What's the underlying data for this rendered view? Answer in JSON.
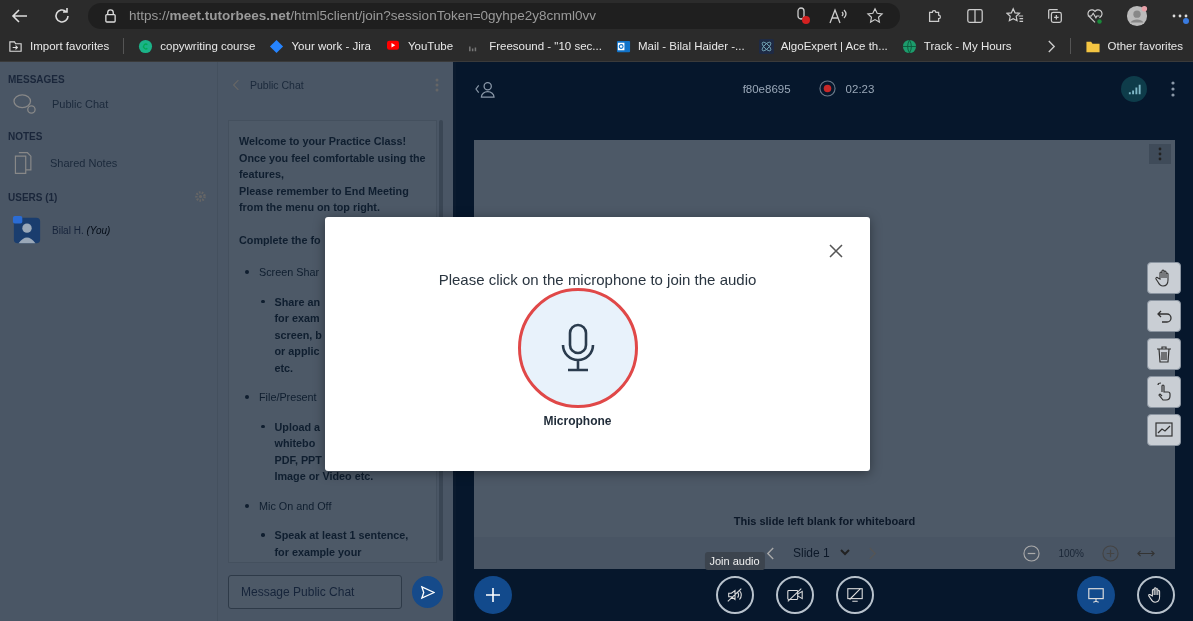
{
  "browser": {
    "url": "https://**meet.tutorbees.net**/html5client/join?sessionToken=0gyhpe2y8cnml0vv",
    "bookmarks": [
      {
        "label": "Import favorites",
        "kind": "import"
      },
      {
        "label": "copywriting course",
        "kind": "letter-circle"
      },
      {
        "label": "Your work - Jira",
        "kind": "diamond"
      },
      {
        "label": "YouTube",
        "kind": "play"
      },
      {
        "label": "Freesound - \"10 sec...",
        "kind": "wave"
      },
      {
        "label": "Mail - Bilal Haider -...",
        "kind": "mail"
      },
      {
        "label": "AlgoExpert | Ace th...",
        "kind": "atom"
      },
      {
        "label": "Track - My Hours",
        "kind": "globe"
      }
    ],
    "other_favorites": "Other favorites"
  },
  "sidebar": {
    "sections": [
      {
        "title": "MESSAGES",
        "items": [
          {
            "label": "Public Chat",
            "kind": "chat"
          }
        ]
      },
      {
        "title": "NOTES",
        "items": [
          {
            "label": "Shared Notes",
            "kind": "notes"
          }
        ]
      }
    ],
    "users_title": "USERS (1)",
    "users": [
      {
        "name": "Bilal H.",
        "suffix": "(You)"
      }
    ]
  },
  "chat": {
    "title": "Public Chat",
    "intro": [
      "Welcome to your Practice Class!",
      "Once you feel comfortable using the features,",
      "Please remember to End Meeting from the menu on top right."
    ],
    "heading": "Complete the fo",
    "bullets": [
      {
        "lines": [
          "Screen Shar"
        ],
        "children": [
          {
            "lines": [
              "Share an",
              "for exam",
              "screen, b",
              "or applic",
              "etc."
            ]
          }
        ]
      },
      {
        "lines": [
          "File/Present"
        ],
        "children": [
          {
            "lines": [
              "Upload a",
              "whitebo",
              "PDF, PPT",
              "Image or Video etc."
            ]
          }
        ]
      },
      {
        "lines": [
          "Mic On and Off"
        ],
        "children": [
          {
            "lines": [
              "Speak at least 1 sentence,",
              "for example your"
            ]
          }
        ]
      }
    ],
    "input": {
      "placeholder": "Message Public Chat"
    }
  },
  "meeting": {
    "name": "f80e8695",
    "time": "02:23",
    "slide_note": "This slide left blank for whiteboard",
    "slide": "Slide 1",
    "zoom": "100%",
    "tooltip": "Join audio"
  },
  "modal": {
    "title": "Please click on the microphone to join the audio",
    "options": [
      {
        "label": "Microphone",
        "kind": "microphone"
      }
    ]
  }
}
